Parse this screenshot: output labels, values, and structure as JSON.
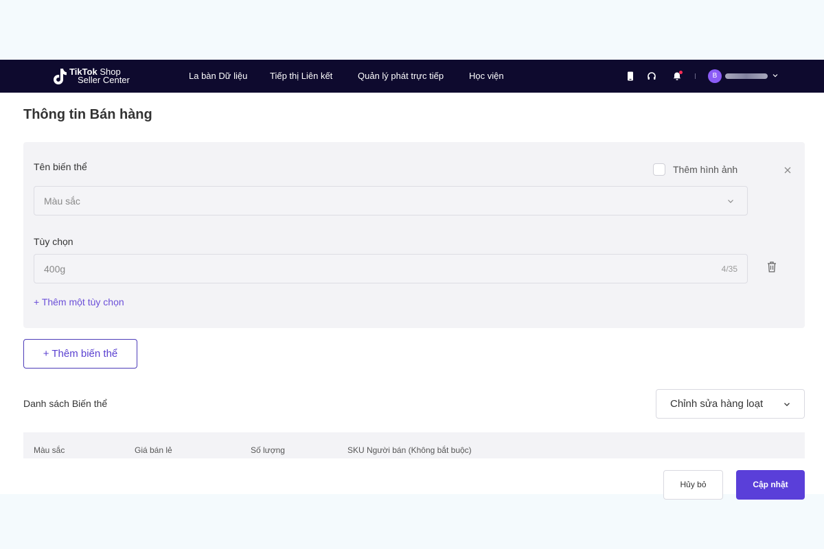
{
  "navbar": {
    "logo": {
      "brand_bold": "TikTok",
      "brand_light": "Shop",
      "subtitle": "Seller Center"
    },
    "items": [
      {
        "label": "La bàn Dữ liệu"
      },
      {
        "label": "Tiếp thị Liên kết"
      },
      {
        "label": "Quản lý phát trực tiếp"
      },
      {
        "label": "Học viện"
      }
    ],
    "icons": [
      "phone-icon",
      "headset-icon",
      "bell-icon"
    ],
    "avatar_glyph": "B",
    "has_notification": true,
    "colors": {
      "bg": "#0e0a2e",
      "notification": "#ff2d55"
    }
  },
  "main": {
    "section_title": "Thông tin Bán hàng",
    "variant": {
      "name_label": "Tên biến thể",
      "name_value": "Màu sắc",
      "add_image_label": "Thêm hình ảnh",
      "options_label": "Tùy chọn",
      "option_value": "400g",
      "option_counter": "4/35",
      "add_option_label": "+ Thêm một tùy chọn"
    },
    "add_variant_label": "+ Thêm biến thể",
    "variant_list_title": "Danh sách Biến thể",
    "bulk_edit_label": "Chỉnh sửa hàng loạt",
    "table_headers": [
      "Màu sắc",
      "Giá bán lẻ",
      "Số lượng",
      "SKU Người bán (Không bắt buộc)"
    ]
  },
  "footer": {
    "cancel_label": "Hủy bỏ",
    "update_label": "Cập nhật"
  },
  "colors": {
    "accent": "#5a3fd9",
    "link": "#6b4fd8"
  }
}
